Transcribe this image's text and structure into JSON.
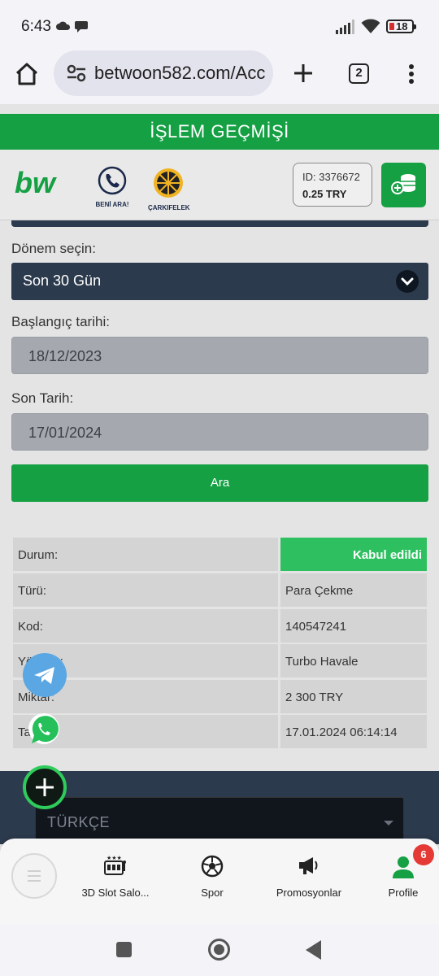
{
  "status_bar": {
    "time": "6:43",
    "battery": "18"
  },
  "browser": {
    "url": "betwoon582.com/Acc",
    "tabs_count": "2"
  },
  "page": {
    "title": "İŞLEM GEÇMİŞİ",
    "brand": {
      "logo_text": "bw",
      "call_label": "BENİ ARA!",
      "wheel_label": "ÇARKIFELEK"
    },
    "account": {
      "id": "ID: 3376672",
      "balance": "0.25 TRY"
    }
  },
  "form": {
    "period_label": "Dönem seçin:",
    "period_value": "Son 30 Gün",
    "start_label": "Başlangıç tarihi:",
    "start_value": "18/12/2023",
    "end_label": "Son Tarih:",
    "end_value": "17/01/2024",
    "search_button": "Ara"
  },
  "result": {
    "rows": [
      {
        "label": "Durum:",
        "value": "Kabul edildi"
      },
      {
        "label": "Türü:",
        "value": "Para Çekme"
      },
      {
        "label": "Kod:",
        "value": "140547241"
      },
      {
        "label": "Yöntem:",
        "value": "Turbo Havale"
      },
      {
        "label": "Miktar:",
        "value": "2 300 TRY"
      },
      {
        "label": "Tarih:",
        "value": "17.01.2024 06:14:14"
      }
    ]
  },
  "footer": {
    "language": "TÜRKÇE"
  },
  "bottom_nav": {
    "items": [
      {
        "label": "3D Slot Salo...",
        "icon": "slot-machine-icon"
      },
      {
        "label": "Spor",
        "icon": "soccer-ball-icon"
      },
      {
        "label": "Promosyonlar",
        "icon": "megaphone-icon"
      },
      {
        "label": "Profile",
        "icon": "user-icon"
      }
    ],
    "profile_badge": "6"
  },
  "colors": {
    "brand_green": "#15a044",
    "status_green": "#2ec060",
    "dark_navy": "#2c3a4d",
    "telegram_blue": "#5ba7e3",
    "badge_red": "#e53935"
  }
}
